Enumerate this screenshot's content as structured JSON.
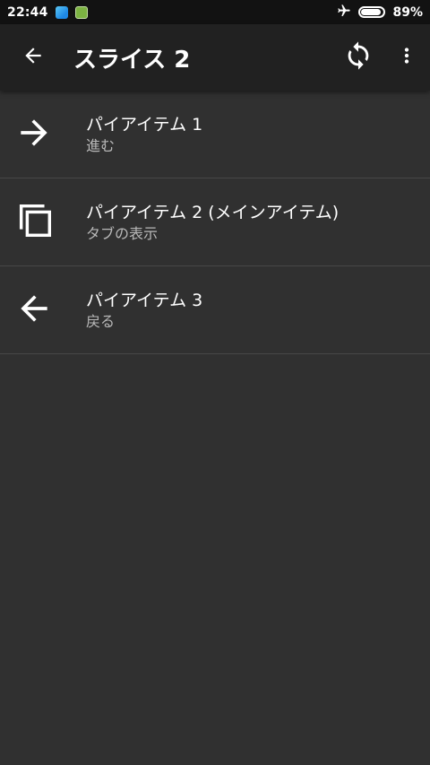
{
  "status_bar": {
    "time": "22:44",
    "battery_percent": "89%",
    "battery_level": 0.89,
    "icons": [
      "weather-app-icon",
      "sim-app-icon",
      "airplane-mode-icon",
      "battery-icon"
    ]
  },
  "app_bar": {
    "title": "スライス 2",
    "back_icon": "arrow-left-icon",
    "refresh_icon": "refresh-icon",
    "more_icon": "more-vert-icon"
  },
  "items": [
    {
      "title": "パイアイテム 1",
      "subtitle": "進む",
      "icon": "arrow-right-icon"
    },
    {
      "title": "パイアイテム 2 (メインアイテム)",
      "subtitle": "タブの表示",
      "icon": "copy-tabs-icon"
    },
    {
      "title": "パイアイテム 3",
      "subtitle": "戻る",
      "icon": "arrow-left-icon"
    }
  ],
  "colors": {
    "background": "#303030",
    "app_bar": "#212121",
    "status_bar": "#121212",
    "divider": "#474747",
    "secondary_text": "#b8b8b8"
  }
}
